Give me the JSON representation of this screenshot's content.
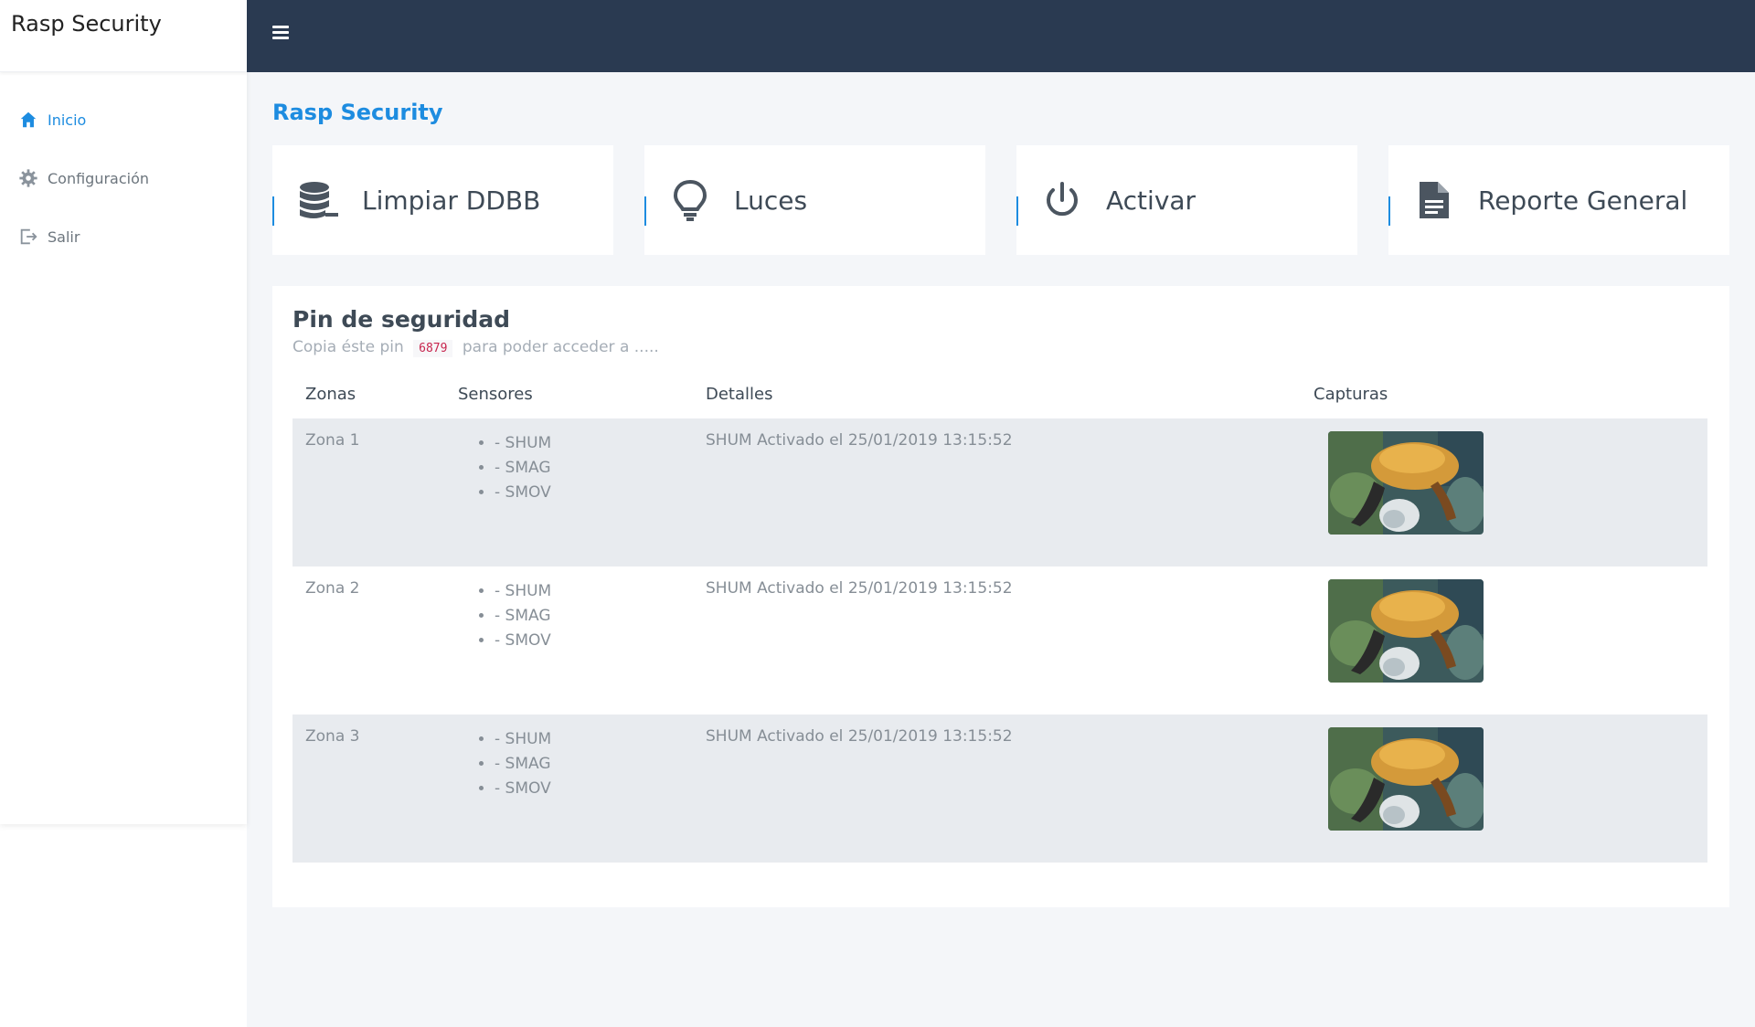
{
  "sidebar": {
    "brand": "Rasp Security",
    "items": [
      {
        "label": "Inicio",
        "icon": "home-icon",
        "active": true
      },
      {
        "label": "Configuración",
        "icon": "gear-icon",
        "active": false
      },
      {
        "label": "Salir",
        "icon": "logout-icon",
        "active": false
      }
    ]
  },
  "topbar": {
    "menu_icon": "hamburger-icon"
  },
  "main": {
    "title": "Rasp Security",
    "cards": [
      {
        "label": "Limpiar DDBB",
        "icon": "database-clear-icon"
      },
      {
        "label": "Luces",
        "icon": "lightbulb-icon"
      },
      {
        "label": "Activar",
        "icon": "power-icon"
      },
      {
        "label": "Reporte General",
        "icon": "document-icon"
      }
    ],
    "panel": {
      "title": "Pin de seguridad",
      "sub_before": "Copia éste pin",
      "pin": "6879",
      "sub_after": "para poder acceder a .....",
      "columns": [
        "Zonas",
        "Sensores",
        "Detalles",
        "Capturas"
      ],
      "rows": [
        {
          "zona": "Zona 1",
          "sensores": [
            "- SHUM",
            "- SMAG",
            "- SMOV"
          ],
          "detalle": "SHUM Activado el 25/01/2019 13:15:52"
        },
        {
          "zona": "Zona 2",
          "sensores": [
            "- SHUM",
            "- SMAG",
            "- SMOV"
          ],
          "detalle": "SHUM Activado el 25/01/2019 13:15:52"
        },
        {
          "zona": "Zona 3",
          "sensores": [
            "- SHUM",
            "- SMAG",
            "- SMOV"
          ],
          "detalle": "SHUM Activado el 25/01/2019 13:15:52"
        }
      ]
    }
  },
  "colors": {
    "accent": "#1d8ce0",
    "topbar": "#2a3a51",
    "background": "#f4f6f9",
    "row_stripe": "#e8ebef"
  }
}
